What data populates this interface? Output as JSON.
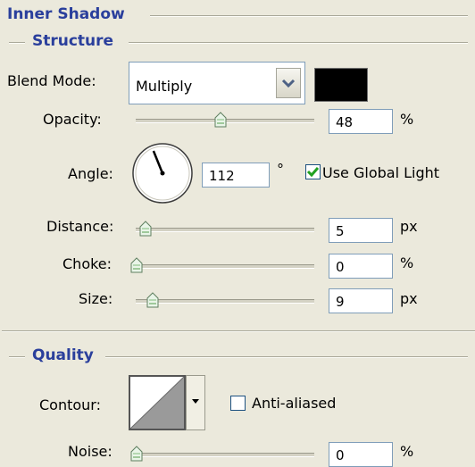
{
  "inner_shadow": {
    "title": "Inner Shadow",
    "structure": {
      "title": "Structure",
      "blend_mode": {
        "label": "Blend Mode:",
        "value": "Multiply",
        "swatch_color": "#000000",
        "dropdown_icon": "chevron-down-icon"
      },
      "opacity": {
        "label": "Opacity:",
        "value": "48",
        "unit": "%",
        "slider_fraction": 0.48
      },
      "angle": {
        "label": "Angle:",
        "value": "112",
        "unit": "°",
        "use_global_light": {
          "label": "Use Global Light",
          "checked": true
        }
      },
      "distance": {
        "label": "Distance:",
        "value": "5",
        "unit": "px",
        "slider_fraction": 0.02
      },
      "choke": {
        "label": "Choke:",
        "value": "0",
        "unit": "%",
        "slider_fraction": 0.0
      },
      "size": {
        "label": "Size:",
        "value": "9",
        "unit": "px",
        "slider_fraction": 0.04
      }
    },
    "quality": {
      "title": "Quality",
      "contour": {
        "label": "Contour:",
        "dropdown_icon": "triangle-down-icon",
        "anti_aliased": {
          "label": "Anti-aliased",
          "checked": false
        }
      },
      "noise": {
        "label": "Noise:",
        "value": "0",
        "unit": "%",
        "slider_fraction": 0.0
      }
    }
  }
}
